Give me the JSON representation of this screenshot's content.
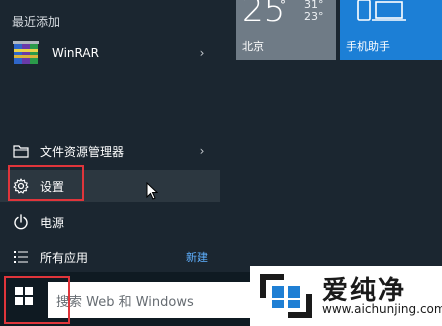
{
  "start_menu": {
    "recently_added_title": "最近添加",
    "recent_items": [
      {
        "label": "WinRAR",
        "icon": "winrar-icon",
        "has_submenu": true
      }
    ],
    "items": [
      {
        "label": "文件资源管理器",
        "icon": "folder-icon",
        "has_submenu": true
      },
      {
        "label": "设置",
        "icon": "gear-icon",
        "highlighted": true
      },
      {
        "label": "电源",
        "icon": "power-icon"
      },
      {
        "label": "所有应用",
        "icon": "list-icon",
        "badge": "新建"
      }
    ]
  },
  "tiles": {
    "weather": {
      "temperature": "25",
      "degree_symbol": "°",
      "high": "31°",
      "low": "23°",
      "label": "北京",
      "color": "#6f7b86"
    },
    "phone_assistant": {
      "label": "手机助手",
      "icon": "phone-laptop-icon",
      "color": "#1c7fd6"
    }
  },
  "taskbar": {
    "start_icon": "windows-logo-icon",
    "search_placeholder": "搜索 Web 和 Windows"
  },
  "watermark": {
    "text_cn": "爱纯净",
    "url": "www.aichunjing.com"
  },
  "colors": {
    "highlight_frame": "#e0353b",
    "accent_link": "#5fb0ff",
    "background": "#1b2630"
  }
}
